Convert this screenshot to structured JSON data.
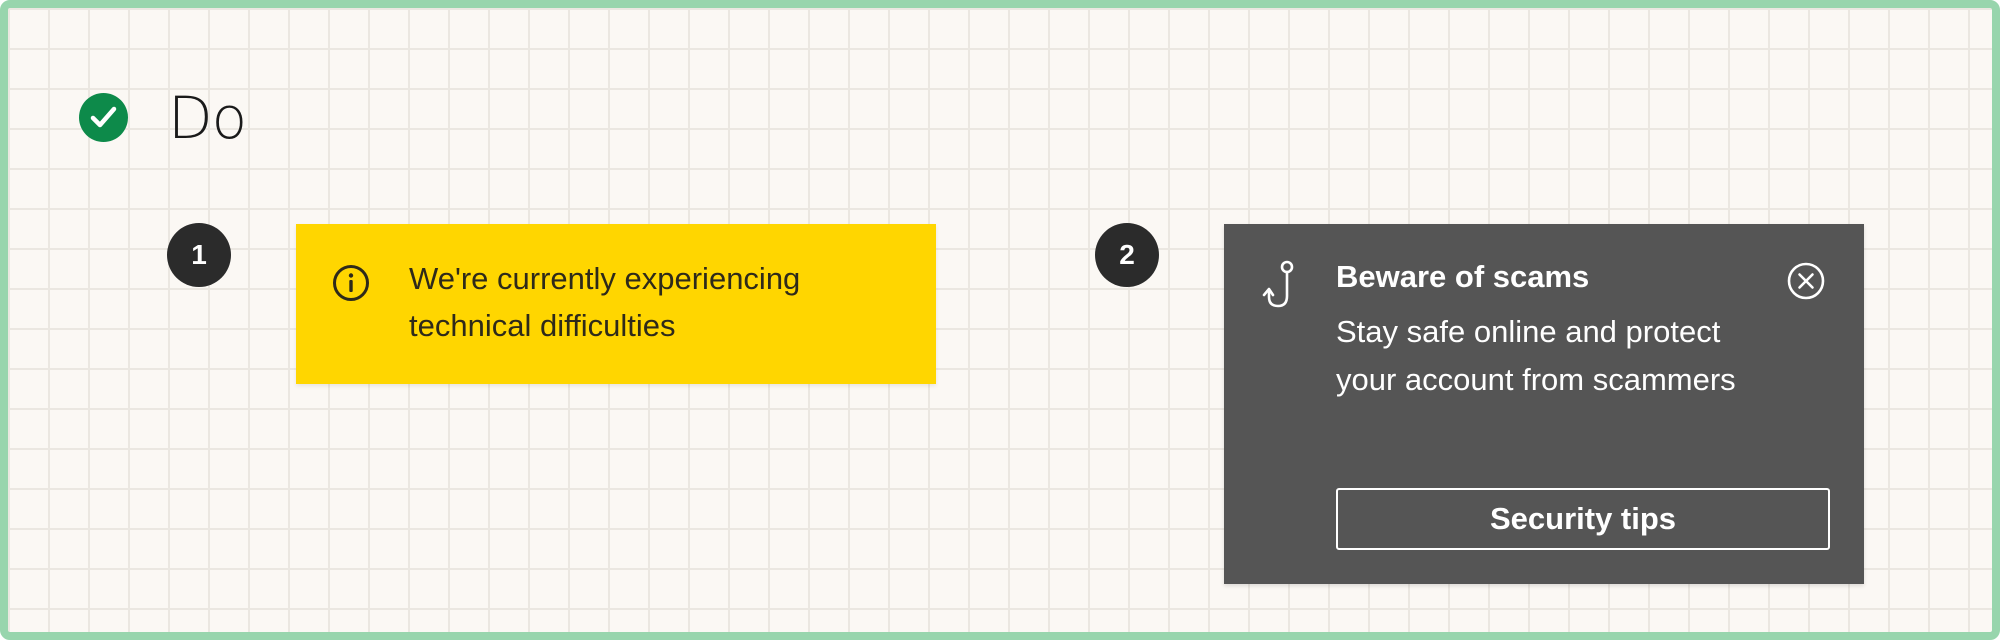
{
  "header": {
    "title": "Do",
    "icon": "check-circle-icon",
    "icon_color": "#0d8a4a"
  },
  "examples": [
    {
      "step": "1",
      "banner": {
        "icon": "info-circle-icon",
        "message": "We're currently experiencing technical difficulties",
        "background": "#ffd600"
      }
    },
    {
      "step": "2",
      "toast": {
        "icon": "fishing-hook-icon",
        "title": "Beware of scams",
        "body": "Stay safe online and protect your account from scammers",
        "button_label": "Security tips",
        "close_icon": "close-circle-icon",
        "background": "#555555"
      }
    }
  ],
  "colors": {
    "frame_border": "#98d5ad",
    "step_badge": "#2b2b2b"
  }
}
